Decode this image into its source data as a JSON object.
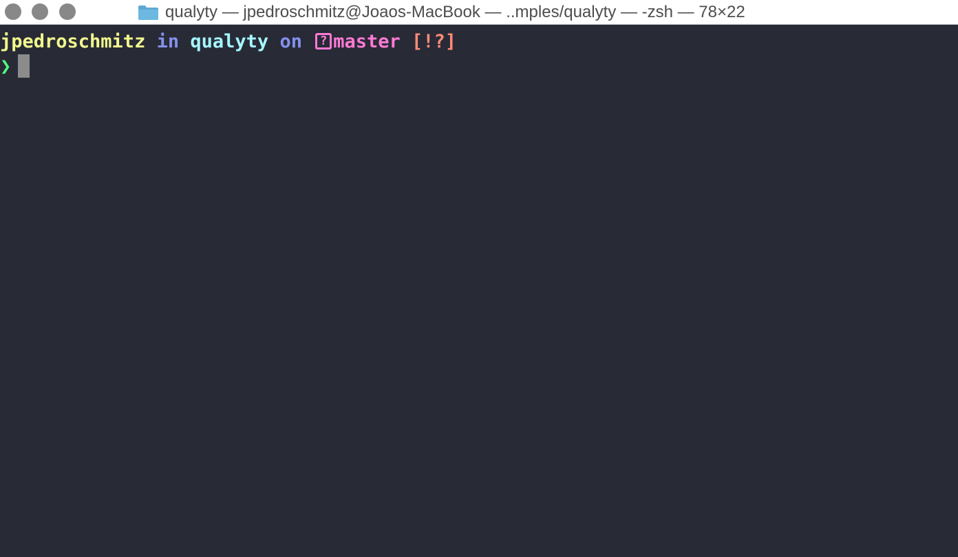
{
  "window": {
    "title": "qualyty — jpedroschmitz@Joaos-MacBook — ..mples/qualyty — -zsh — 78×22",
    "title_icon": "folder-icon"
  },
  "colors": {
    "background": "#282a36",
    "user": "#f1fa8c",
    "keyword": "#8490ec",
    "directory": "#a4f7ff",
    "branch": "#ff7ad4",
    "git_status": "#ff8a78",
    "prompt": "#50fa7b",
    "cursor": "#8b8b8b"
  },
  "terminal": {
    "prompt_line": {
      "user": "jpedroschmitz",
      "in_word": "in",
      "directory": "qualyty",
      "on_word": "on",
      "branch_icon_glyph": "?",
      "branch": "master",
      "git_status": "[!?]"
    },
    "input_line": {
      "prompt_symbol": "❯",
      "input_value": ""
    }
  }
}
